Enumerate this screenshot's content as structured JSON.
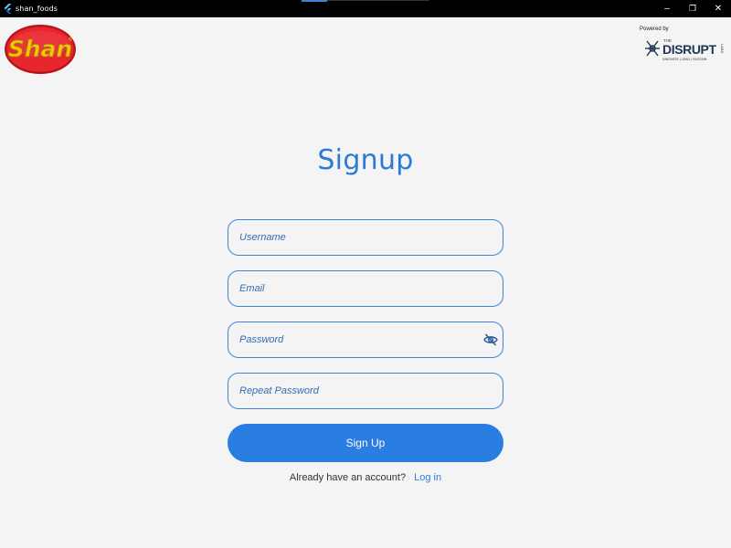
{
  "window": {
    "title": "shan_foods",
    "controls": {
      "minimize": "–",
      "maximize": "❐",
      "close": "✕"
    }
  },
  "header": {
    "brand_logo_text": "Shan",
    "brand_logo_mark": "®",
    "powered_by": "Powered by",
    "partner": {
      "the": "THE",
      "name": "DISRUPT",
      "labs": "LABS",
      "tagline": "INNOVATE | LEAD | SUSTAIN"
    }
  },
  "form": {
    "title": "Signup",
    "fields": {
      "username": {
        "placeholder": "Username",
        "value": ""
      },
      "email": {
        "placeholder": "Email",
        "value": ""
      },
      "password": {
        "placeholder": "Password",
        "value": "",
        "toggle_icon": "eye-off-icon"
      },
      "repeat_password": {
        "placeholder": "Repeat Password",
        "value": ""
      }
    },
    "submit_label": "Sign Up",
    "login_prompt": "Already have an account?",
    "login_link": "Log in"
  },
  "colors": {
    "accent": "#2a7de1",
    "title": "#2b7bd6",
    "field_border": "#3d86d8",
    "background": "#f4f4f4",
    "titlebar": "#000000",
    "shan_red": "#d7262b",
    "shan_yellow": "#f7c400"
  }
}
